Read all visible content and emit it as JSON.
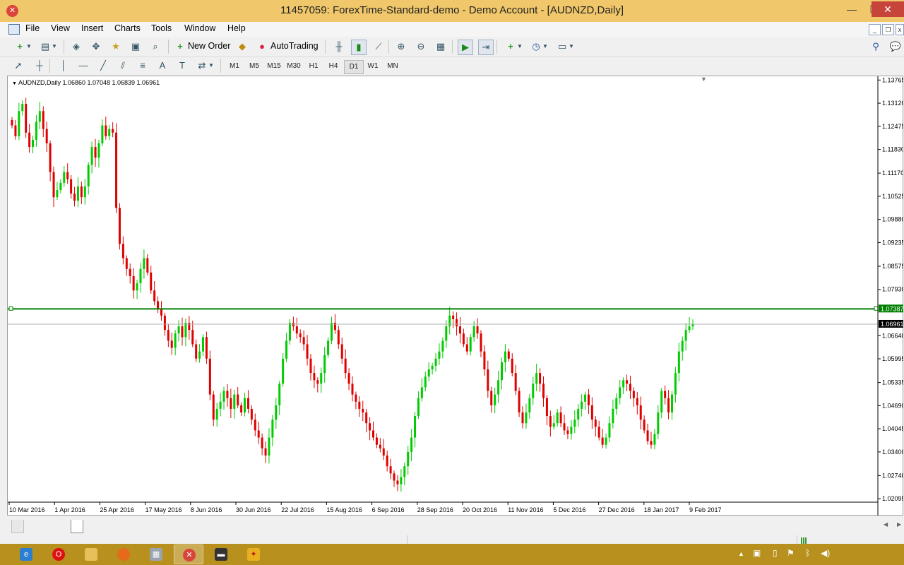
{
  "window": {
    "title": "11457059: ForexTime-Standard-demo - Demo Account - [AUDNZD,Daily]"
  },
  "menu": [
    "File",
    "View",
    "Insert",
    "Charts",
    "Tools",
    "Window",
    "Help"
  ],
  "toolbar": {
    "new_order_label": "New Order",
    "autotrading_label": "AutoTrading"
  },
  "timeframes": [
    "M1",
    "M5",
    "M15",
    "M30",
    "H1",
    "H4",
    "D1",
    "W1",
    "MN"
  ],
  "active_timeframe": "D1",
  "chart": {
    "info": "AUDNZD,Daily  1.06860 1.07048 1.06839 1.06961",
    "price_ticks": [
      "1.13765",
      "1.13120",
      "1.12475",
      "1.11830",
      "1.11170",
      "1.10525",
      "1.09880",
      "1.09235",
      "1.08575",
      "1.07930",
      "1.06640",
      "1.05995",
      "1.05335",
      "1.04690",
      "1.04045",
      "1.03400",
      "1.02740",
      "1.02095"
    ],
    "hline_label": "1.07387",
    "bid_label": "1.06961",
    "date_ticks": [
      "10 Mar 2016",
      "1 Apr 2016",
      "25 Apr 2016",
      "17 May 2016",
      "8 Jun 2016",
      "30 Jun 2016",
      "22 Jul 2016",
      "15 Aug 2016",
      "6 Sep 2016",
      "28 Sep 2016",
      "20 Oct 2016",
      "11 Nov 2016",
      "5 Dec 2016",
      "27 Dec 2016",
      "18 Jan 2017",
      "9 Feb 2017"
    ],
    "colors": {
      "bull": "#00cc00",
      "bear": "#e00000",
      "hline": "#008000",
      "grid": "#c0c0c0"
    }
  },
  "chart_data": {
    "type": "candlestick",
    "symbol": "AUDNZD",
    "timeframe": "Daily",
    "ylim": [
      1.02,
      1.1385
    ],
    "levels": {
      "hline": 1.07387,
      "bid": 1.06961
    },
    "last": {
      "open": 1.0686,
      "high": 1.07048,
      "low": 1.06839,
      "close": 1.06961
    },
    "closes": [
      1.125,
      1.122,
      1.129,
      1.131,
      1.123,
      1.119,
      1.121,
      1.126,
      1.129,
      1.124,
      1.12,
      1.112,
      1.105,
      1.107,
      1.109,
      1.112,
      1.11,
      1.106,
      1.104,
      1.108,
      1.105,
      1.108,
      1.114,
      1.119,
      1.116,
      1.12,
      1.125,
      1.122,
      1.124,
      1.123,
      1.102,
      1.092,
      1.088,
      1.085,
      1.083,
      1.079,
      1.081,
      1.085,
      1.088,
      1.084,
      1.079,
      1.076,
      1.074,
      1.072,
      1.068,
      1.065,
      1.063,
      1.067,
      1.069,
      1.066,
      1.07,
      1.068,
      1.064,
      1.06,
      1.062,
      1.066,
      1.06,
      1.05,
      1.043,
      1.046,
      1.048,
      1.051,
      1.049,
      1.046,
      1.05,
      1.047,
      1.045,
      1.049,
      1.046,
      1.043,
      1.04,
      1.038,
      1.035,
      1.033,
      1.038,
      1.043,
      1.047,
      1.053,
      1.06,
      1.065,
      1.07,
      1.069,
      1.067,
      1.066,
      1.064,
      1.06,
      1.056,
      1.054,
      1.053,
      1.056,
      1.061,
      1.065,
      1.07,
      1.068,
      1.064,
      1.06,
      1.056,
      1.053,
      1.05,
      1.048,
      1.046,
      1.045,
      1.042,
      1.04,
      1.038,
      1.036,
      1.035,
      1.033,
      1.03,
      1.028,
      1.026,
      1.025,
      1.027,
      1.03,
      1.034,
      1.038,
      1.044,
      1.049,
      1.052,
      1.055,
      1.057,
      1.058,
      1.06,
      1.062,
      1.065,
      1.069,
      1.072,
      1.071,
      1.069,
      1.067,
      1.064,
      1.062,
      1.066,
      1.069,
      1.067,
      1.062,
      1.057,
      1.051,
      1.047,
      1.05,
      1.054,
      1.059,
      1.062,
      1.06,
      1.056,
      1.051,
      1.045,
      1.042,
      1.045,
      1.049,
      1.053,
      1.056,
      1.053,
      1.049,
      1.044,
      1.041,
      1.042,
      1.045,
      1.042,
      1.04,
      1.039,
      1.041,
      1.043,
      1.046,
      1.048,
      1.05,
      1.047,
      1.043,
      1.041,
      1.038,
      1.036,
      1.038,
      1.042,
      1.046,
      1.049,
      1.052,
      1.054,
      1.053,
      1.051,
      1.049,
      1.047,
      1.043,
      1.04,
      1.037,
      1.036,
      1.039,
      1.045,
      1.051,
      1.049,
      1.045,
      1.05,
      1.056,
      1.062,
      1.065,
      1.068,
      1.069,
      1.0696
    ]
  }
}
